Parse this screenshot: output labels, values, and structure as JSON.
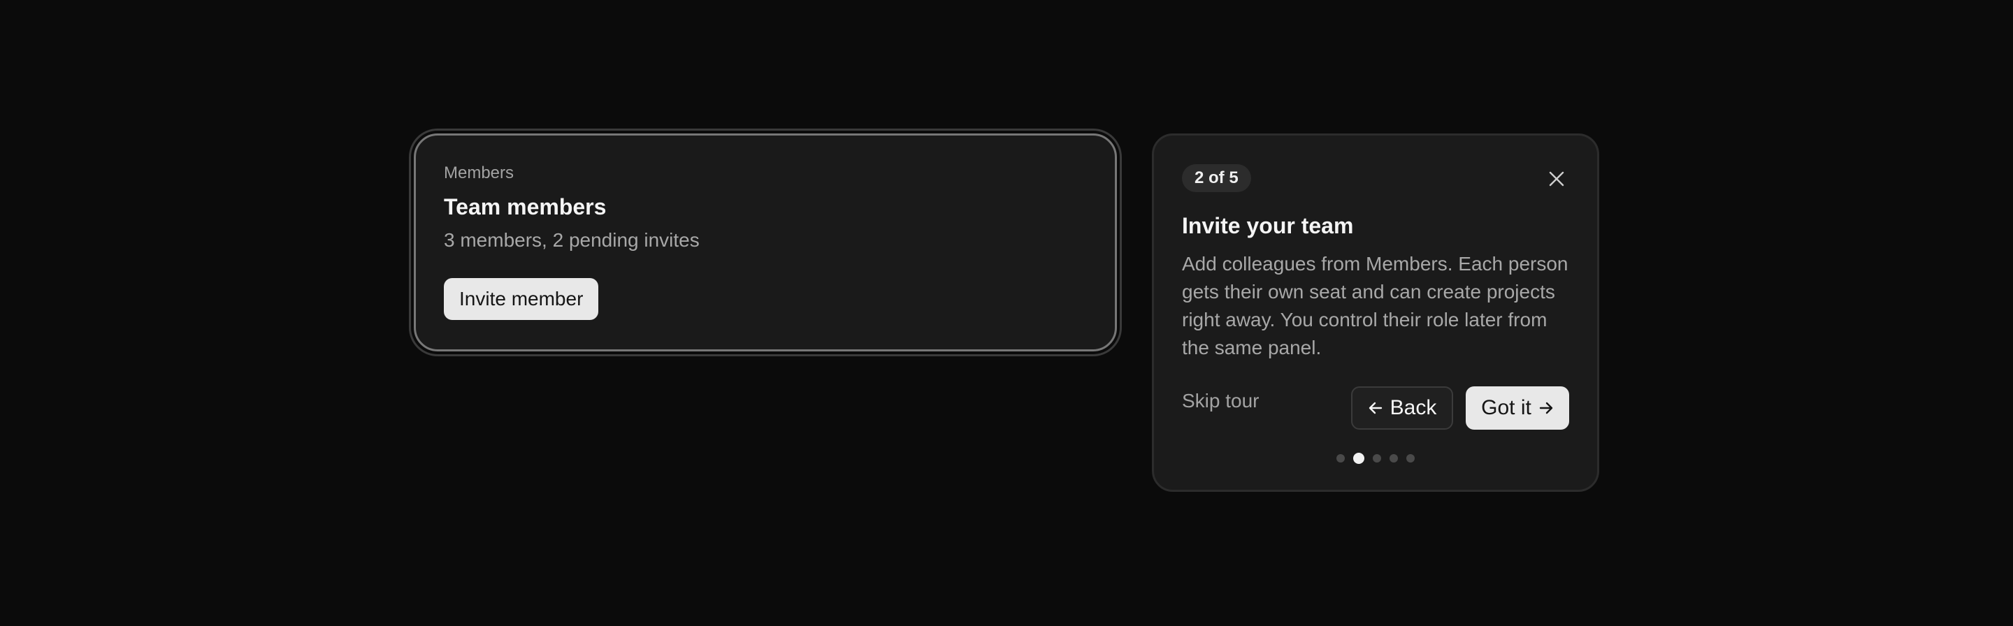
{
  "members_card": {
    "eyebrow": "Members",
    "title": "Team members",
    "subtitle": "3 members, 2 pending invites",
    "invite_label": "Invite member"
  },
  "tour": {
    "step_label": "2 of 5",
    "current_step": 2,
    "total_steps": 5,
    "title": "Invite your team",
    "body": "Add colleagues from Members. Each person gets their own seat and can create projects right away. You control their role later from the same panel.",
    "skip_label": "Skip tour",
    "back_label": "Back",
    "next_label": "Got it",
    "close_icon": "close-icon",
    "back_icon": "arrow-left-icon",
    "next_icon": "arrow-right-icon"
  },
  "colors": {
    "background": "#0b0b0b",
    "card": "#1a1a1a",
    "primary_button": "#e8e8e8",
    "highlight_ring": "#777777",
    "active_dot": "#f2f2f2",
    "inactive_dot": "#4a4a4a"
  }
}
